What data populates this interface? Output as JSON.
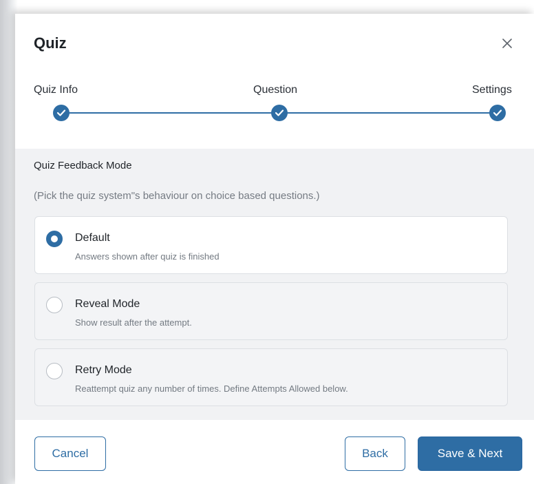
{
  "dialog": {
    "title": "Quiz",
    "close_icon": "close-icon"
  },
  "steps": [
    {
      "label": "Quiz Info",
      "status": "complete",
      "icon": "check-icon"
    },
    {
      "label": "Question",
      "status": "complete",
      "icon": "check-icon"
    },
    {
      "label": "Settings",
      "status": "complete",
      "icon": "check-icon"
    }
  ],
  "feedback_mode": {
    "title": "Quiz Feedback Mode",
    "hint": "(Pick the quiz system\"s behaviour on choice based questions.)",
    "options": [
      {
        "title": "Default",
        "description": "Answers shown after quiz is finished",
        "selected": true
      },
      {
        "title": "Reveal Mode",
        "description": "Show result after the attempt.",
        "selected": false
      },
      {
        "title": "Retry Mode",
        "description": "Reattempt quiz any number of times. Define Attempts Allowed below.",
        "selected": false
      }
    ]
  },
  "footer": {
    "cancel_label": "Cancel",
    "back_label": "Back",
    "save_next_label": "Save & Next"
  },
  "colors": {
    "accent": "#2e6da4",
    "panel_background": "#f1f2f4"
  }
}
